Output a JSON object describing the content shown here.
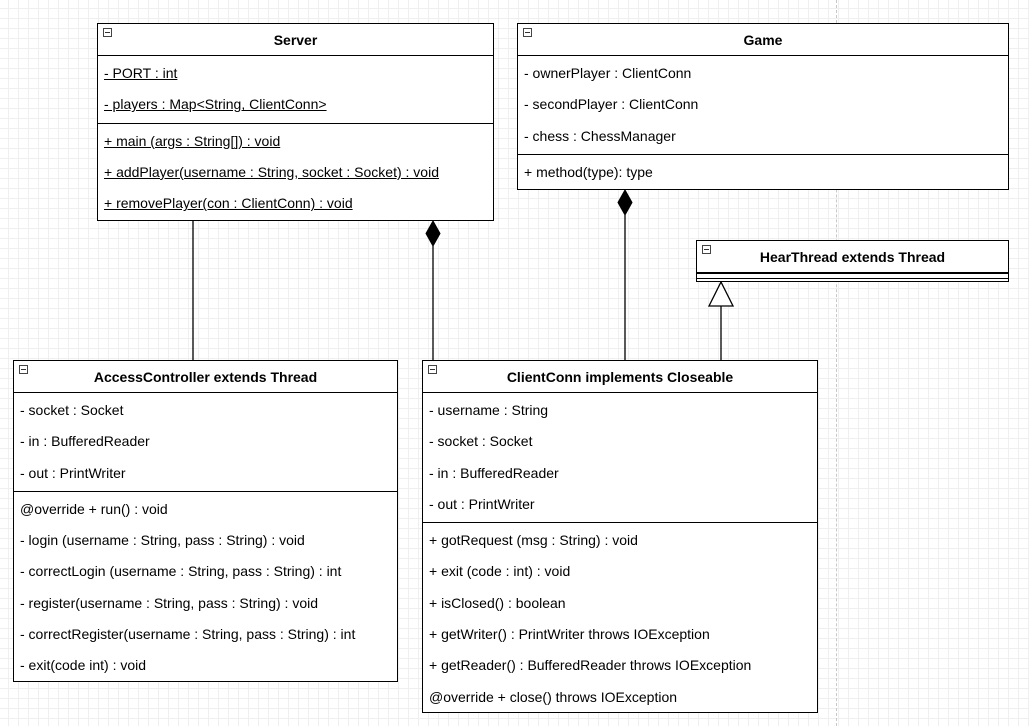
{
  "classes": {
    "server": {
      "name": "Server",
      "attributes": [
        "- PORT : int",
        "- players : Map<String, ClientConn>"
      ],
      "methods": [
        "+ main (args : String[]) : void",
        "+ addPlayer(username : String, socket : Socket) : void",
        "+ removePlayer(con : ClientConn) : void"
      ]
    },
    "game": {
      "name": "Game",
      "attributes": [
        "- ownerPlayer : ClientConn",
        "- secondPlayer : ClientConn",
        "- chess : ChessManager"
      ],
      "methods": [
        "+ method(type): type"
      ]
    },
    "hear_thread": {
      "name": "HearThread extends Thread"
    },
    "access_controller": {
      "name": "AccessController extends Thread",
      "attributes": [
        "- socket : Socket",
        "- in : BufferedReader",
        "- out : PrintWriter"
      ],
      "methods": [
        "@override + run() : void",
        "- login (username : String, pass : String) : void",
        "- correctLogin (username : String, pass : String) : int",
        "- register(username : String, pass : String) : void",
        "- correctRegister(username : String, pass : String) : int",
        "- exit(code int) : void"
      ]
    },
    "client_conn": {
      "name": "ClientConn implements Closeable",
      "attributes": [
        "- username : String",
        "- socket : Socket",
        "- in : BufferedReader",
        "- out : PrintWriter"
      ],
      "methods": [
        "+ gotRequest (msg : String) : void",
        "+ exit (code : int) : void",
        "+ isClosed() : boolean",
        "+ getWriter() : PrintWriter throws IOException",
        "+ getReader() : BufferedReader throws IOException",
        "@override + close() throws IOException"
      ]
    }
  },
  "relationships": [
    {
      "type": "association",
      "from": "Server",
      "to": "AccessController extends Thread"
    },
    {
      "type": "composition",
      "whole": "Server",
      "part": "ClientConn implements Closeable"
    },
    {
      "type": "composition",
      "whole": "Game",
      "part": "ClientConn implements Closeable"
    },
    {
      "type": "inheritance",
      "child": "ClientConn implements Closeable",
      "parent": "HearThread extends Thread"
    }
  ]
}
